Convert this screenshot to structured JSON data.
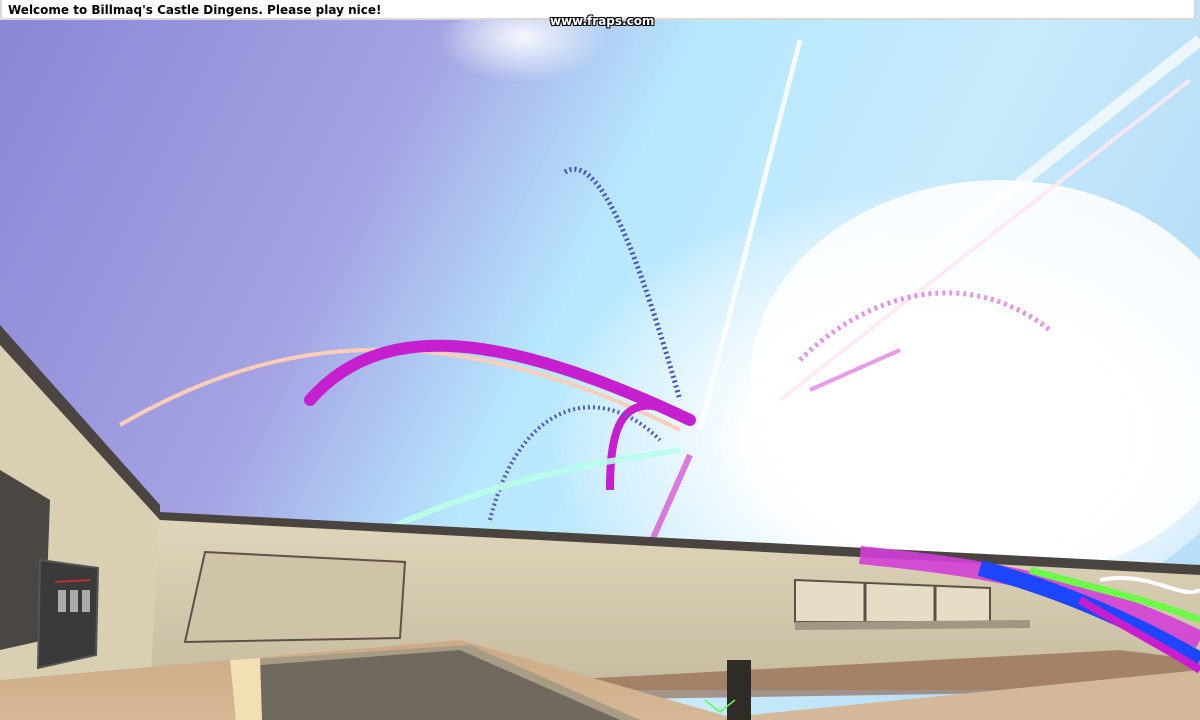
{
  "hud": {
    "chat_message": "Welcome to Billmaq's Castle Dingens. Please play nice!",
    "watermark": "www.fraps.com"
  },
  "colors": {
    "sky_light": "#e7f3fb",
    "sky_purple": "#8d84d6",
    "sky_cyan": "#b8ecff",
    "wall": "#d8cdb0",
    "wall_shadow": "#b9ae94",
    "floor": "#c9a98a",
    "magenta": "#c81ecf",
    "peach": "#ffd6c2",
    "green": "#5fff42",
    "blue": "#1b4dff"
  }
}
